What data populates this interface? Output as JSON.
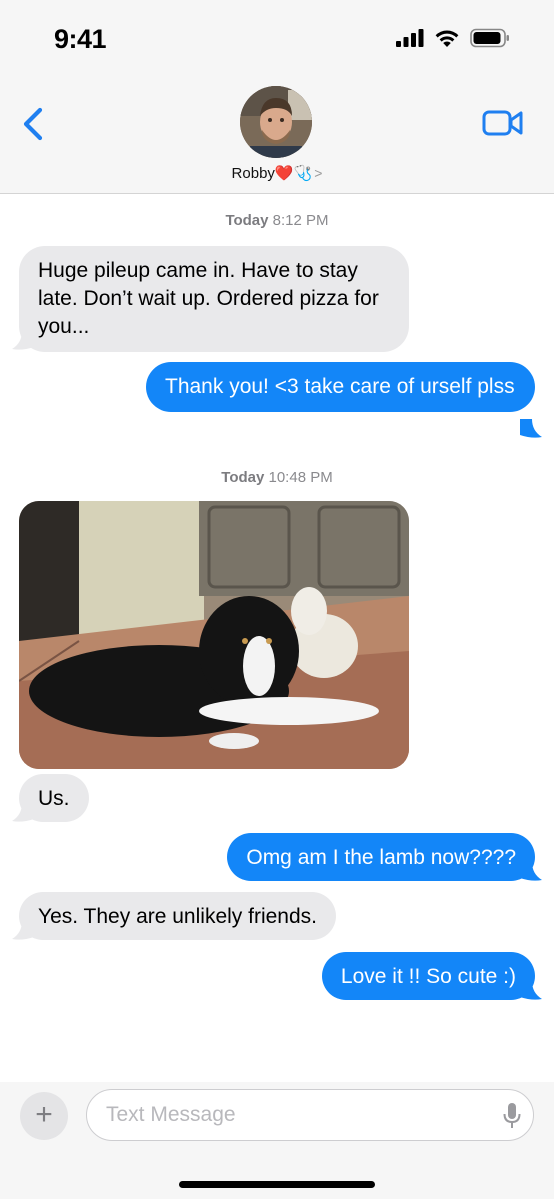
{
  "status": {
    "time": "9:41"
  },
  "header": {
    "contact_name": "Robby❤️🩺",
    "chevron": ">"
  },
  "messages": [
    {
      "type": "timestamp",
      "day": "Today",
      "time": "8:12 PM"
    },
    {
      "type": "incoming",
      "text": "Huge pileup came in. Have to stay late. Don’t wait up. Ordered pizza for you..."
    },
    {
      "type": "outgoing",
      "text": "Thank you! <3 take care of urself plss"
    },
    {
      "type": "timestamp",
      "day": "Today",
      "time": "10:48 PM"
    },
    {
      "type": "incoming-image",
      "alt": "dog and lamb photo"
    },
    {
      "type": "incoming",
      "text": "Us."
    },
    {
      "type": "outgoing",
      "text": "Omg am I the lamb now????"
    },
    {
      "type": "incoming",
      "text": "Yes. They are unlikely friends."
    },
    {
      "type": "outgoing",
      "text": "Love it !! So cute :)"
    }
  ],
  "composer": {
    "placeholder": "Text Message",
    "plus": "+"
  },
  "colors": {
    "outgoing": "#1386f8",
    "incoming": "#e9e9eb",
    "accent": "#1f7ff0"
  },
  "icons": [
    "back-chevron-icon",
    "video-call-icon",
    "signal-icon",
    "wifi-icon",
    "battery-icon",
    "plus-icon",
    "mic-icon"
  ]
}
